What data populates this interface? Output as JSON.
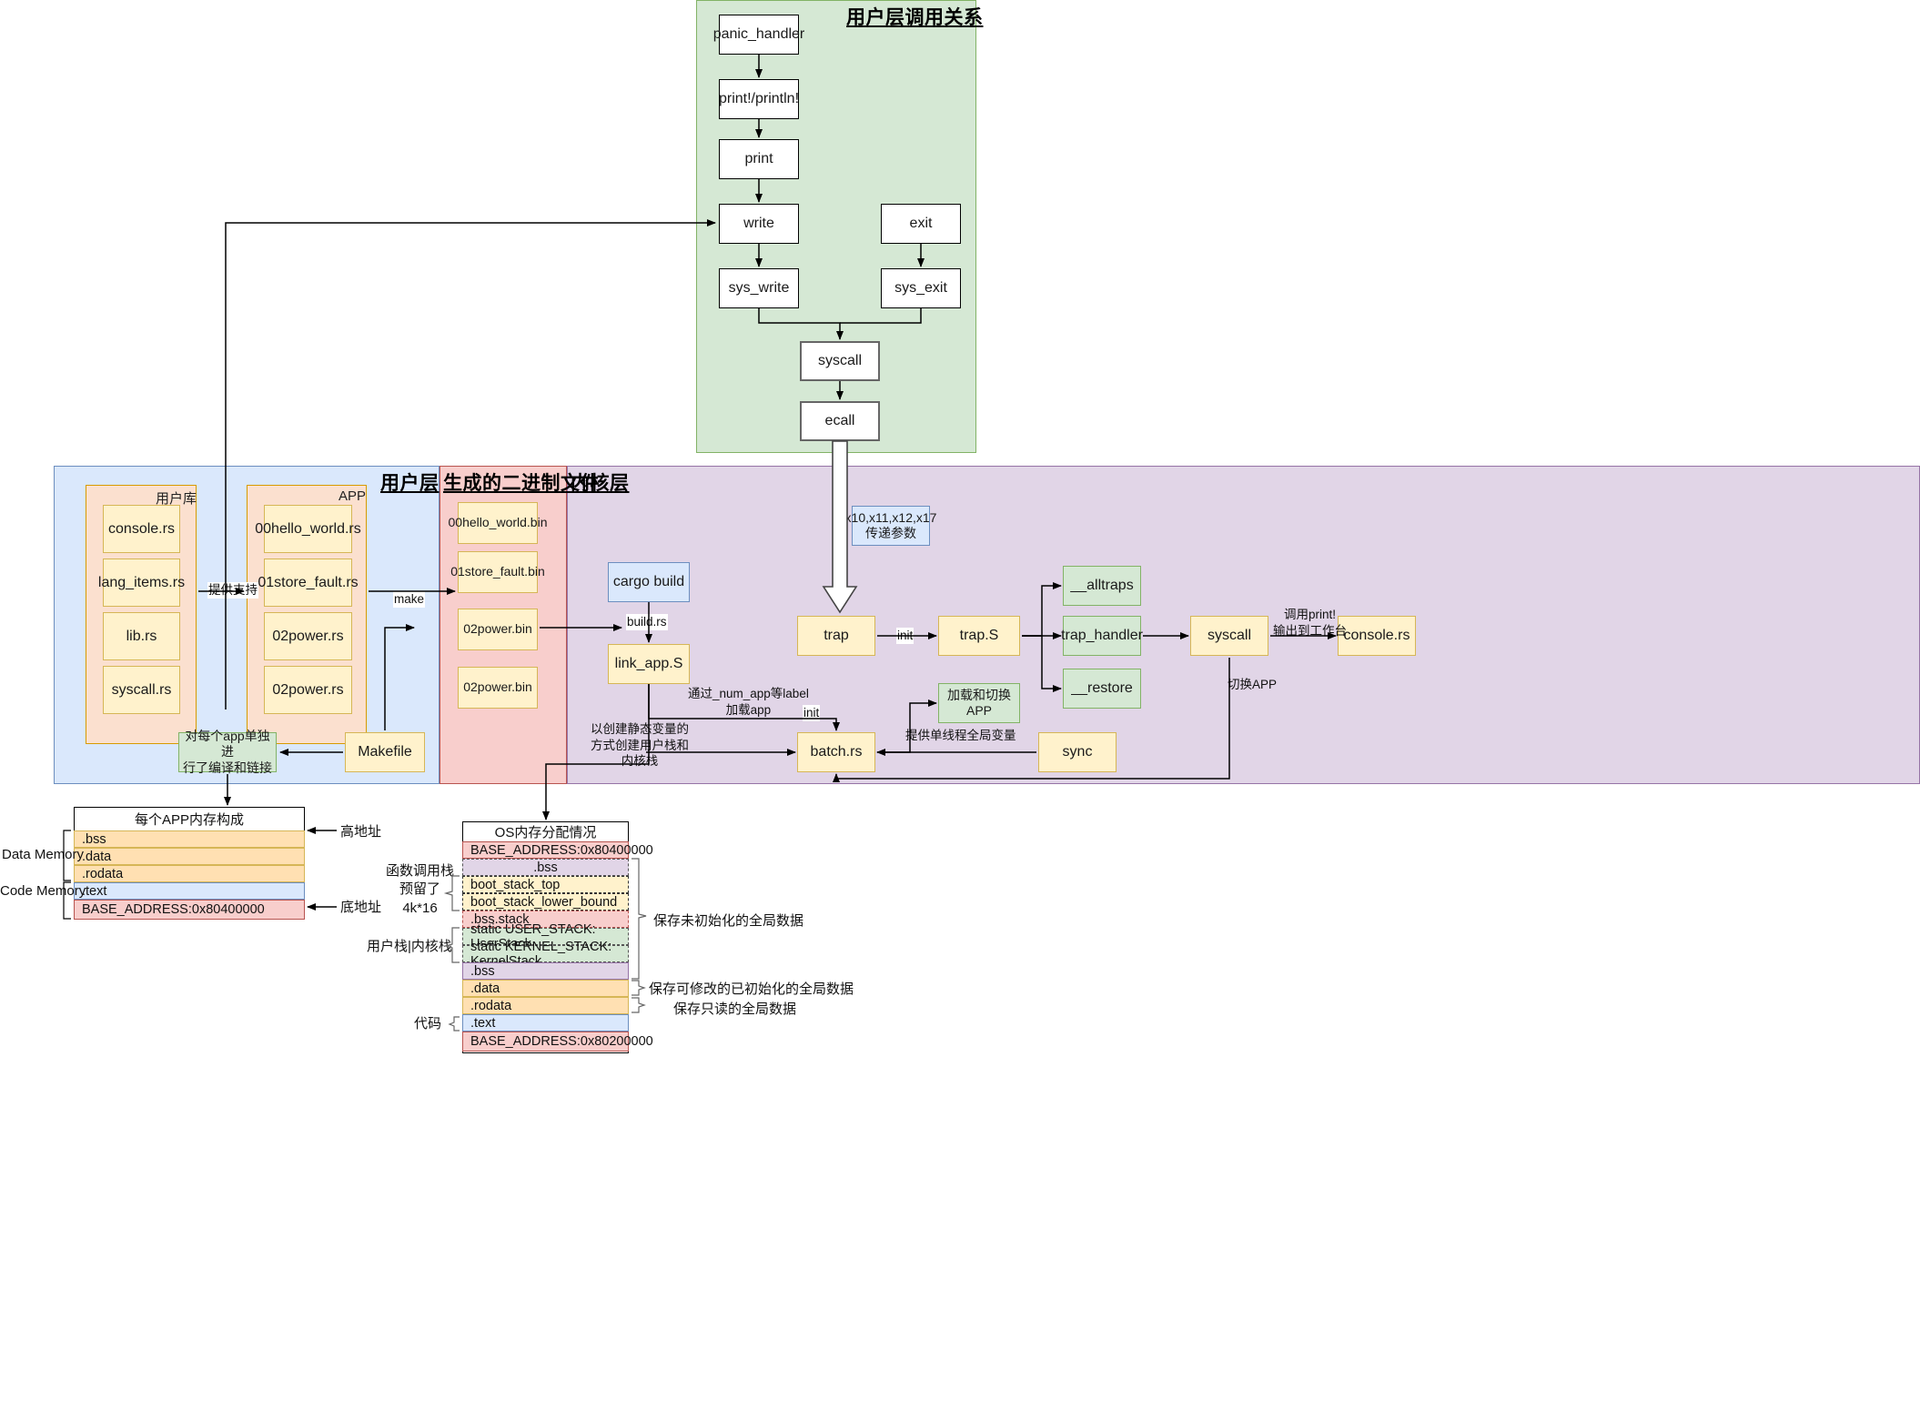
{
  "panels": {
    "user_call_relation": {
      "title": "用户层调用关系"
    },
    "user_layer": {
      "title": "用户层"
    },
    "binaries": {
      "title": "生成的二进制文件"
    },
    "kernel_layer": {
      "title": "内核层"
    }
  },
  "user_call_nodes": {
    "panic_handler": "panic_handler",
    "print_macro": "print!/println!",
    "print": "print",
    "write": "write",
    "exit": "exit",
    "sys_write": "sys_write",
    "sys_exit": "sys_exit",
    "syscall": "syscall",
    "ecall": "ecall"
  },
  "user_lib": {
    "group_label": "用户库",
    "items": [
      "console.rs",
      "lang_items.rs",
      "lib.rs",
      "syscall.rs"
    ]
  },
  "app": {
    "group_label": "APP",
    "items": [
      "00hello_world.rs",
      "01store_fault.rs",
      "02power.rs",
      "02power.rs"
    ]
  },
  "binaries": {
    "items": [
      "00hello_world.bin",
      "01store_fault.bin",
      "02power.bin",
      "02power.bin"
    ]
  },
  "user_layer_nodes": {
    "makefile": "Makefile",
    "compile_note": "对每个app单独进\n行了编译和链接"
  },
  "kernel_nodes": {
    "cargo_build": "cargo build",
    "link_app": "link_app.S",
    "batch": "batch.rs",
    "sync": "sync",
    "trap": "trap",
    "trap_s": "trap.S",
    "alltraps": "__alltraps",
    "trap_handler": "trap_handler",
    "restore": "__restore",
    "syscall": "syscall",
    "console": "console.rs",
    "load_switch_app": "加载和切换APP",
    "regs_note": "x10,x11,x12,x17\n传递参数"
  },
  "edge_labels": {
    "provide_support": "提供支持",
    "make": "make",
    "build_rs": "build.rs",
    "load_app": "通过_num_app等label\n加载app",
    "static_stacks": "以创建静态变量的\n方式创建用户栈和\n内核栈",
    "init1": "init",
    "init2": "init",
    "single_thread_global": "提供单线程全局变量",
    "call_print": "调用print!\n输出到工作台",
    "switch_app": "切换APP"
  },
  "app_memory": {
    "title": "每个APP内存构成",
    "rows": [
      {
        "label": ".bss",
        "color": "#ffe0b2"
      },
      {
        "label": ".data",
        "color": "#ffe0b2"
      },
      {
        "label": ".rodata",
        "color": "#ffe0b2"
      },
      {
        "label": ".text",
        "color": "#dae8fc"
      },
      {
        "label": "BASE_ADDRESS:0x80400000",
        "color": "#f8cecc"
      }
    ],
    "side_labels": {
      "data_memory": "Data Memory",
      "code_memory": "Code Memory"
    },
    "annotations": {
      "high": "高地址",
      "low": "底地址"
    }
  },
  "os_memory": {
    "title": "OS内存分配情况",
    "rows": [
      {
        "label": "BASE_ADDRESS:0x80400000",
        "color": "#f8cecc",
        "center": false
      },
      {
        "label": ".bss",
        "color": "#e1d5e7",
        "center": true
      },
      {
        "label": "boot_stack_top",
        "color": "#fff2cc",
        "center": false
      },
      {
        "label": "boot_stack_lower_bound",
        "color": "#fff2cc",
        "center": false
      },
      {
        "label": ".bss.stack",
        "color": "#f8cecc",
        "center": false
      },
      {
        "label": "static USER_STACK: UserStack",
        "color": "#d5e8d4",
        "center": false
      },
      {
        "label": "static KERNEL_STACK: KernelStack",
        "color": "#d5e8d4",
        "center": false
      },
      {
        "label": ".bss",
        "color": "#e1d5e7",
        "center": false
      },
      {
        "label": ".data",
        "color": "#ffe0b2",
        "center": false
      },
      {
        "label": ".rodata",
        "color": "#ffe0b2",
        "center": false
      },
      {
        "label": ".text",
        "color": "#dae8fc",
        "center": false
      },
      {
        "label": "BASE_ADDRESS:0x80200000",
        "color": "#f8cecc",
        "center": false
      }
    ],
    "left_notes": {
      "call_stack": "函数调用栈\n预留了\n4k*16",
      "user_kernel_stack": "用户栈|内核栈",
      "code": "代码"
    },
    "right_notes": {
      "uninit_global": "保存未初始化的全局数据",
      "mutable_global": "保存可修改的已初始化的全局数据",
      "readonly_global": "保存只读的全局数据"
    }
  },
  "colors": {
    "green_panel": "#d5e8d4",
    "green_border": "#82b366",
    "blue_panel": "#dae8fc",
    "blue_border": "#6c8ebf",
    "red_panel": "#f8cecc",
    "red_border": "#b85450",
    "purple_panel": "#e1d5e7",
    "purple_border": "#9673a6",
    "yellow_node": "#fff2cc",
    "yellow_border": "#d6b656",
    "orange_group": "#fbe0cf",
    "orange_border": "#d79b00"
  }
}
